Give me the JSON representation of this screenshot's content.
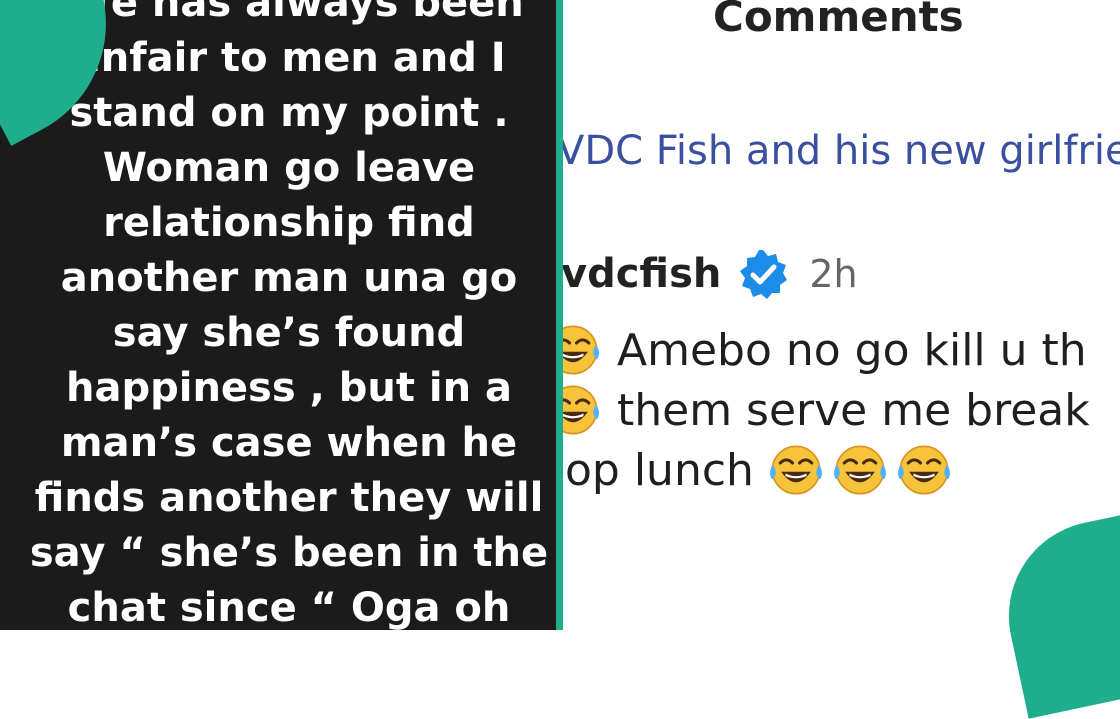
{
  "left_post": {
    "lines": [
      "Life has always been",
      "unfair to men and I",
      "stand on my point .",
      "Woman go leave",
      "relationship find",
      "another man una go",
      "say she’s found",
      "happiness , but in a",
      "man’s case when he",
      "finds another they will",
      "say “ she’s been in the",
      "chat since “ Oga oh"
    ]
  },
  "right_comments": {
    "title": "Comments",
    "post_ref": "VDC Fish and his new girlfriend",
    "comment": {
      "username": "vdcfish",
      "verified_icon": "verified-badge-icon",
      "time": "2h",
      "line1": "Amebo no go kill u th",
      "line2": "them serve me break",
      "line3": "op lunch",
      "emoji_icon": "tears-of-joy-emoji"
    }
  },
  "colors": {
    "accent": "#1fae8b",
    "left_background": "#1b1b1b",
    "link_blue": "#3a4fa0",
    "verified_blue": "#1d8ce8",
    "emoji_yellow": "#f7c33b"
  }
}
